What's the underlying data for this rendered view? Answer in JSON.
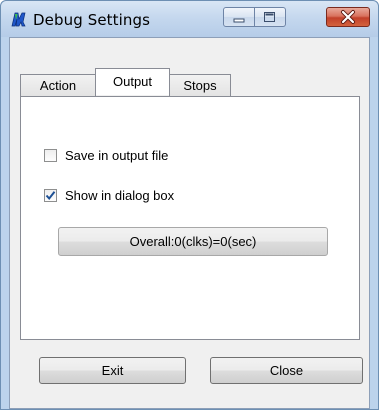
{
  "window": {
    "title": "Debug Settings"
  },
  "tabs": [
    {
      "label": "Action",
      "active": false
    },
    {
      "label": "Output",
      "active": true
    },
    {
      "label": "Stops",
      "active": false
    }
  ],
  "output_tab": {
    "save_in_output_file": {
      "label": "Save in output file",
      "checked": false
    },
    "show_in_dialog_box": {
      "label": "Show in dialog box",
      "checked": true
    },
    "overall_button_label": "Overall:0(clks)=0(sec)"
  },
  "footer": {
    "exit_label": "Exit",
    "close_label": "Close"
  },
  "colors": {
    "titlebar": "#c5d8ee",
    "close_button": "#c2402a",
    "check_mark": "#1c4f94"
  }
}
